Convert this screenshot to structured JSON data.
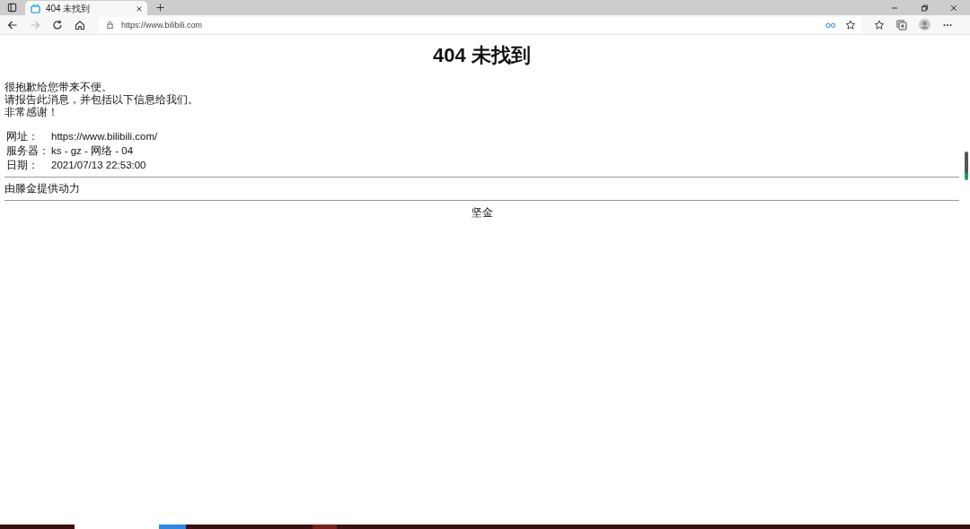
{
  "browser": {
    "tabs": [
      {
        "title": "404 未找到",
        "selected": true
      }
    ],
    "address": "https://www.bilibili.com"
  },
  "page": {
    "heading": "404 未找到",
    "message_lines": [
      "很抱歉给您带来不便。",
      "请报告此消息，并包括以下信息给我们。",
      "非常感谢！"
    ],
    "info_rows": [
      {
        "label": "网址：",
        "value": "https://www.bilibili.com/"
      },
      {
        "label": "服务器：",
        "value": "ks - gz - 网络 - 04"
      },
      {
        "label": "日期：",
        "value": "2021/07/13 22:53:00"
      }
    ],
    "powered_by": "由滕金提供动力",
    "footer": "坚金"
  }
}
